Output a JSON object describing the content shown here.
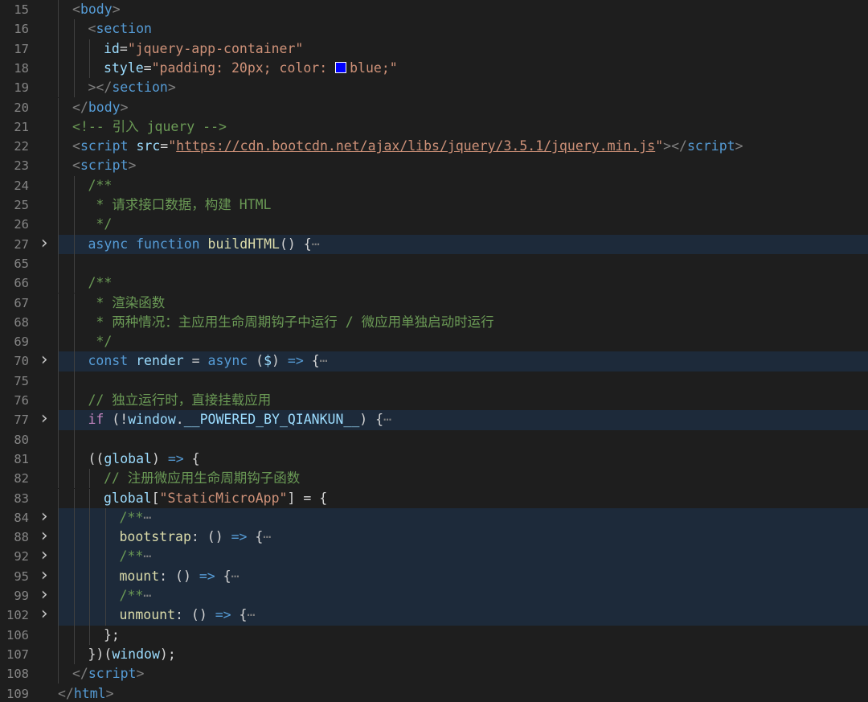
{
  "editor": {
    "language": "html",
    "colors": {
      "background": "#1e1e1e",
      "tag": "#569cd6",
      "attribute": "#9cdcfe",
      "string": "#ce9178",
      "comment": "#6a9955",
      "keyword": "#569cd6",
      "control": "#c586c0",
      "function": "#dcdcaa",
      "swatch": "#0000ff"
    },
    "lines": [
      {
        "num": "15",
        "folded": false,
        "highlight": false,
        "indent": 1,
        "tokens": [
          [
            "punc",
            "<"
          ],
          [
            "tag",
            "body"
          ],
          [
            "punc",
            ">"
          ]
        ]
      },
      {
        "num": "16",
        "folded": false,
        "highlight": false,
        "indent": 2,
        "tokens": [
          [
            "punc",
            "<"
          ],
          [
            "tag",
            "section"
          ]
        ]
      },
      {
        "num": "17",
        "folded": false,
        "highlight": false,
        "indent": 3,
        "tokens": [
          [
            "attr",
            "id"
          ],
          [
            "plain",
            "="
          ],
          [
            "str",
            "\"jquery-app-container\""
          ]
        ]
      },
      {
        "num": "18",
        "folded": false,
        "highlight": false,
        "indent": 3,
        "tokens": [
          [
            "attr",
            "style"
          ],
          [
            "plain",
            "="
          ],
          [
            "str",
            "\"padding: 20px; color: "
          ],
          [
            "swatch",
            ""
          ],
          [
            "str",
            "blue;\""
          ]
        ]
      },
      {
        "num": "19",
        "folded": false,
        "highlight": false,
        "indent": 2,
        "tokens": [
          [
            "punc",
            "></"
          ],
          [
            "tag",
            "section"
          ],
          [
            "punc",
            ">"
          ]
        ]
      },
      {
        "num": "20",
        "folded": false,
        "highlight": false,
        "indent": 1,
        "tokens": [
          [
            "punc",
            "</"
          ],
          [
            "tag",
            "body"
          ],
          [
            "punc",
            ">"
          ]
        ]
      },
      {
        "num": "21",
        "folded": false,
        "highlight": false,
        "indent": 1,
        "tokens": [
          [
            "cmt",
            "<!-- 引入 jquery -->"
          ]
        ]
      },
      {
        "num": "22",
        "folded": false,
        "highlight": false,
        "indent": 1,
        "tokens": [
          [
            "punc",
            "<"
          ],
          [
            "tag",
            "script"
          ],
          [
            "plain",
            " "
          ],
          [
            "attr",
            "src"
          ],
          [
            "plain",
            "="
          ],
          [
            "str",
            "\""
          ],
          [
            "link",
            "https://cdn.bootcdn.net/ajax/libs/jquery/3.5.1/jquery.min.js"
          ],
          [
            "str",
            "\""
          ],
          [
            "punc",
            "></"
          ],
          [
            "tag",
            "script"
          ],
          [
            "punc",
            ">"
          ]
        ]
      },
      {
        "num": "23",
        "folded": false,
        "highlight": false,
        "indent": 1,
        "tokens": [
          [
            "punc",
            "<"
          ],
          [
            "tag",
            "script"
          ],
          [
            "punc",
            ">"
          ]
        ]
      },
      {
        "num": "24",
        "folded": false,
        "highlight": false,
        "indent": 2,
        "tokens": [
          [
            "cmt",
            "/**"
          ]
        ]
      },
      {
        "num": "25",
        "folded": false,
        "highlight": false,
        "indent": 2,
        "tokens": [
          [
            "cmt",
            " * 请求接口数据，构建 HTML"
          ]
        ]
      },
      {
        "num": "26",
        "folded": false,
        "highlight": false,
        "indent": 2,
        "tokens": [
          [
            "cmt",
            " */"
          ]
        ]
      },
      {
        "num": "27",
        "folded": true,
        "highlight": true,
        "indent": 2,
        "tokens": [
          [
            "kw",
            "async"
          ],
          [
            "plain",
            " "
          ],
          [
            "kw",
            "function"
          ],
          [
            "plain",
            " "
          ],
          [
            "fn",
            "buildHTML"
          ],
          [
            "plain",
            "() {"
          ],
          [
            "ell",
            "⋯"
          ]
        ]
      },
      {
        "num": "65",
        "folded": false,
        "highlight": false,
        "indent": 2,
        "tokens": []
      },
      {
        "num": "66",
        "folded": false,
        "highlight": false,
        "indent": 2,
        "tokens": [
          [
            "cmt",
            "/**"
          ]
        ]
      },
      {
        "num": "67",
        "folded": false,
        "highlight": false,
        "indent": 2,
        "tokens": [
          [
            "cmt",
            " * 渲染函数"
          ]
        ]
      },
      {
        "num": "68",
        "folded": false,
        "highlight": false,
        "indent": 2,
        "tokens": [
          [
            "cmt",
            " * 两种情况：主应用生命周期钩子中运行 / 微应用单独启动时运行"
          ]
        ]
      },
      {
        "num": "69",
        "folded": false,
        "highlight": false,
        "indent": 2,
        "tokens": [
          [
            "cmt",
            " */"
          ]
        ]
      },
      {
        "num": "70",
        "folded": true,
        "highlight": true,
        "indent": 2,
        "tokens": [
          [
            "kw",
            "const"
          ],
          [
            "plain",
            " "
          ],
          [
            "var",
            "render"
          ],
          [
            "plain",
            " = "
          ],
          [
            "kw",
            "async"
          ],
          [
            "plain",
            " ("
          ],
          [
            "var",
            "$"
          ],
          [
            "plain",
            ") "
          ],
          [
            "kw",
            "=>"
          ],
          [
            "plain",
            " {"
          ],
          [
            "ell",
            "⋯"
          ]
        ]
      },
      {
        "num": "75",
        "folded": false,
        "highlight": false,
        "indent": 2,
        "tokens": []
      },
      {
        "num": "76",
        "folded": false,
        "highlight": false,
        "indent": 2,
        "tokens": [
          [
            "cmt",
            "// 独立运行时，直接挂载应用"
          ]
        ]
      },
      {
        "num": "77",
        "folded": true,
        "highlight": true,
        "indent": 2,
        "tokens": [
          [
            "ctrl",
            "if"
          ],
          [
            "plain",
            " (!"
          ],
          [
            "var",
            "window"
          ],
          [
            "plain",
            "."
          ],
          [
            "var",
            "__POWERED_BY_QIANKUN__"
          ],
          [
            "plain",
            ") {"
          ],
          [
            "ell",
            "⋯"
          ]
        ]
      },
      {
        "num": "80",
        "folded": false,
        "highlight": false,
        "indent": 2,
        "tokens": []
      },
      {
        "num": "81",
        "folded": false,
        "highlight": false,
        "indent": 2,
        "tokens": [
          [
            "plain",
            "(("
          ],
          [
            "var",
            "global"
          ],
          [
            "plain",
            ") "
          ],
          [
            "kw",
            "=>"
          ],
          [
            "plain",
            " {"
          ]
        ]
      },
      {
        "num": "82",
        "folded": false,
        "highlight": false,
        "indent": 3,
        "tokens": [
          [
            "cmt",
            "// 注册微应用生命周期钩子函数"
          ]
        ]
      },
      {
        "num": "83",
        "folded": false,
        "highlight": false,
        "indent": 3,
        "tokens": [
          [
            "var",
            "global"
          ],
          [
            "plain",
            "["
          ],
          [
            "str",
            "\"StaticMicroApp\""
          ],
          [
            "plain",
            "] = {"
          ]
        ]
      },
      {
        "num": "84",
        "folded": true,
        "highlight": true,
        "indent": 4,
        "tokens": [
          [
            "cmt",
            "/**"
          ],
          [
            "ell",
            "⋯"
          ]
        ]
      },
      {
        "num": "88",
        "folded": true,
        "highlight": true,
        "indent": 4,
        "tokens": [
          [
            "fn",
            "bootstrap"
          ],
          [
            "plain",
            ": () "
          ],
          [
            "kw",
            "=>"
          ],
          [
            "plain",
            " {"
          ],
          [
            "ell",
            "⋯"
          ]
        ]
      },
      {
        "num": "92",
        "folded": true,
        "highlight": true,
        "indent": 4,
        "tokens": [
          [
            "cmt",
            "/**"
          ],
          [
            "ell",
            "⋯"
          ]
        ]
      },
      {
        "num": "95",
        "folded": true,
        "highlight": true,
        "indent": 4,
        "tokens": [
          [
            "fn",
            "mount"
          ],
          [
            "plain",
            ": () "
          ],
          [
            "kw",
            "=>"
          ],
          [
            "plain",
            " {"
          ],
          [
            "ell",
            "⋯"
          ]
        ]
      },
      {
        "num": "99",
        "folded": true,
        "highlight": true,
        "indent": 4,
        "tokens": [
          [
            "cmt",
            "/**"
          ],
          [
            "ell",
            "⋯"
          ]
        ]
      },
      {
        "num": "102",
        "folded": true,
        "highlight": true,
        "indent": 4,
        "tokens": [
          [
            "fn",
            "unmount"
          ],
          [
            "plain",
            ": () "
          ],
          [
            "kw",
            "=>"
          ],
          [
            "plain",
            " {"
          ],
          [
            "ell",
            "⋯"
          ]
        ]
      },
      {
        "num": "106",
        "folded": false,
        "highlight": false,
        "indent": 3,
        "tokens": [
          [
            "plain",
            "};"
          ]
        ]
      },
      {
        "num": "107",
        "folded": false,
        "highlight": false,
        "indent": 2,
        "tokens": [
          [
            "plain",
            "})("
          ],
          [
            "var",
            "window"
          ],
          [
            "plain",
            ");"
          ]
        ]
      },
      {
        "num": "108",
        "folded": false,
        "highlight": false,
        "indent": 1,
        "tokens": [
          [
            "punc",
            "</"
          ],
          [
            "tag",
            "script"
          ],
          [
            "punc",
            ">"
          ]
        ]
      },
      {
        "num": "109",
        "folded": false,
        "highlight": false,
        "indent": 0,
        "tokens": [
          [
            "punc",
            "</"
          ],
          [
            "tag",
            "html"
          ],
          [
            "punc",
            ">"
          ]
        ]
      }
    ]
  }
}
